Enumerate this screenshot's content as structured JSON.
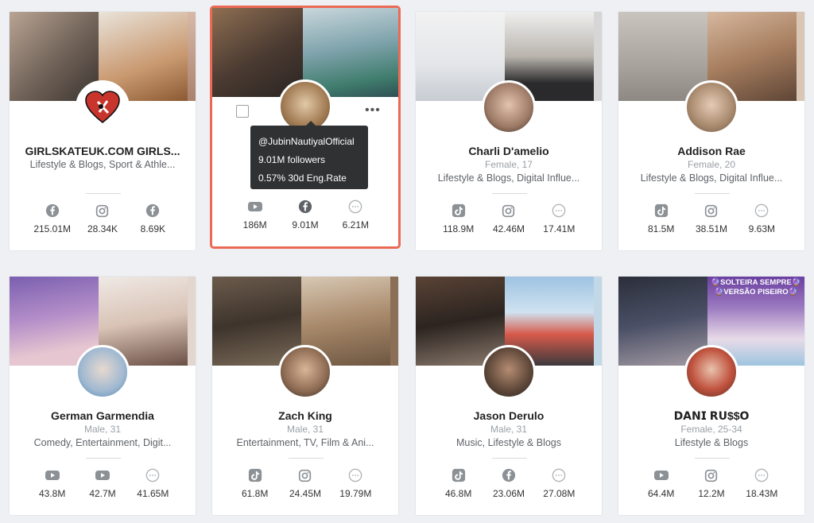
{
  "cards": [
    {
      "name": "GIRLSKATEUK.COM GIRLS...",
      "demographics": "",
      "categories": "Lifestyle & Blogs, Sport & Athle...",
      "metrics": [
        {
          "platform": "facebook-icon",
          "value": "215.01M"
        },
        {
          "platform": "instagram-icon",
          "value": "28.34K"
        },
        {
          "platform": "facebook-icon",
          "value": "8.69K"
        }
      ]
    },
    {
      "name": "",
      "demographics": "",
      "categories": "",
      "selected": true,
      "tooltip": {
        "handle": "@JubinNautiyalOfficial",
        "followers": "9.01M followers",
        "eng_rate": "0.57% 30d Eng.Rate"
      },
      "metrics": [
        {
          "platform": "youtube-icon",
          "value": "186M"
        },
        {
          "platform": "facebook-icon",
          "value": "9.01M"
        },
        {
          "platform": "more-platforms-icon",
          "value": "6.21M"
        }
      ]
    },
    {
      "name": "Charli D'amelio",
      "demographics": "Female, 17",
      "categories": "Lifestyle & Blogs, Digital Influe...",
      "metrics": [
        {
          "platform": "tiktok-icon",
          "value": "118.9M"
        },
        {
          "platform": "instagram-icon",
          "value": "42.46M"
        },
        {
          "platform": "more-platforms-icon",
          "value": "17.41M"
        }
      ]
    },
    {
      "name": "Addison Rae",
      "demographics": "Female, 20",
      "categories": "Lifestyle & Blogs, Digital Influe...",
      "metrics": [
        {
          "platform": "tiktok-icon",
          "value": "81.5M"
        },
        {
          "platform": "instagram-icon",
          "value": "38.51M"
        },
        {
          "platform": "more-platforms-icon",
          "value": "9.63M"
        }
      ]
    },
    {
      "name": "German Garmendia",
      "demographics": "Male, 31",
      "categories": "Comedy, Entertainment, Digit...",
      "metrics": [
        {
          "platform": "youtube-icon",
          "value": "43.8M"
        },
        {
          "platform": "youtube-icon",
          "value": "42.7M"
        },
        {
          "platform": "more-platforms-icon",
          "value": "41.65M"
        }
      ]
    },
    {
      "name": "Zach King",
      "demographics": "Male, 31",
      "categories": "Entertainment, TV, Film & Ani...",
      "metrics": [
        {
          "platform": "tiktok-icon",
          "value": "61.8M"
        },
        {
          "platform": "instagram-icon",
          "value": "24.45M"
        },
        {
          "platform": "more-platforms-icon",
          "value": "19.79M"
        }
      ]
    },
    {
      "name": "Jason Derulo",
      "demographics": "Male, 31",
      "categories": "Music, Lifestyle & Blogs",
      "metrics": [
        {
          "platform": "tiktok-icon",
          "value": "46.8M"
        },
        {
          "platform": "facebook-icon",
          "value": "23.06M"
        },
        {
          "platform": "more-platforms-icon",
          "value": "27.08M"
        }
      ]
    },
    {
      "name": "𝗗𝗔𝗡𝗜 𝗥𝗨$$𝗢",
      "demographics": "Female, 25-34",
      "categories": "Lifestyle & Blogs",
      "banner_text": "🔮SOLTEIRA SEMPRE🔮\n🔮VERSÃO PISEIRO🔮",
      "metrics": [
        {
          "platform": "youtube-icon",
          "value": "64.4M"
        },
        {
          "platform": "instagram-icon",
          "value": "12.2M"
        },
        {
          "platform": "more-platforms-icon",
          "value": "18.43M"
        }
      ]
    }
  ],
  "colors": {
    "selected_outline": "#ec6a55",
    "icon_gray": "#8c9196",
    "tooltip_bg": "#2f3133"
  }
}
